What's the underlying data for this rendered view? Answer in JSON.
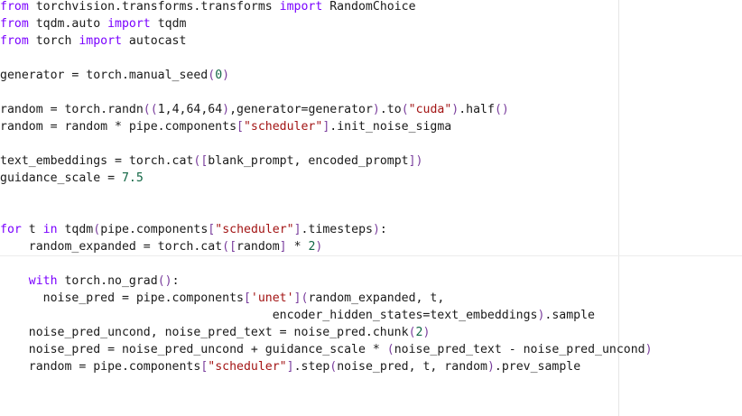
{
  "editor": {
    "lines": [
      [
        {
          "t": "from",
          "c": "kw"
        },
        {
          "t": " torchvision.transforms.transforms "
        },
        {
          "t": "import",
          "c": "kw"
        },
        {
          "t": " RandomChoice"
        }
      ],
      [
        {
          "t": "from",
          "c": "kw"
        },
        {
          "t": " tqdm.auto "
        },
        {
          "t": "import",
          "c": "kw"
        },
        {
          "t": " tqdm"
        }
      ],
      [
        {
          "t": "from",
          "c": "kw"
        },
        {
          "t": " torch "
        },
        {
          "t": "import",
          "c": "kw"
        },
        {
          "t": " autocast"
        }
      ],
      [],
      [
        {
          "t": "generator = torch.manual_seed"
        },
        {
          "t": "(",
          "c": "br"
        },
        {
          "t": "0",
          "c": "num"
        },
        {
          "t": ")",
          "c": "br"
        }
      ],
      [],
      [
        {
          "t": "random = torch.randn"
        },
        {
          "t": "((",
          "c": "br"
        },
        {
          "t": "1,4,64,64"
        },
        {
          "t": ")",
          "c": "br"
        },
        {
          "t": ",generator=generator"
        },
        {
          "t": ")",
          "c": "br"
        },
        {
          "t": ".to"
        },
        {
          "t": "(",
          "c": "br"
        },
        {
          "t": "\"cuda\"",
          "c": "str"
        },
        {
          "t": ")",
          "c": "br"
        },
        {
          "t": ".half"
        },
        {
          "t": "()",
          "c": "br"
        }
      ],
      [
        {
          "t": "random = random * pipe.components"
        },
        {
          "t": "[",
          "c": "br"
        },
        {
          "t": "\"scheduler\"",
          "c": "str"
        },
        {
          "t": "]",
          "c": "br"
        },
        {
          "t": ".init_noise_sigma"
        }
      ],
      [],
      [
        {
          "t": "text_embeddings = torch.cat"
        },
        {
          "t": "([",
          "c": "br"
        },
        {
          "t": "blank_prompt, encoded_prompt"
        },
        {
          "t": "])",
          "c": "br"
        }
      ],
      [
        {
          "t": "guidance_scale = "
        },
        {
          "t": "7.5",
          "c": "num"
        }
      ],
      [],
      [],
      [
        {
          "t": "for",
          "c": "kw"
        },
        {
          "t": " t "
        },
        {
          "t": "in",
          "c": "kw"
        },
        {
          "t": " tqdm"
        },
        {
          "t": "(",
          "c": "br"
        },
        {
          "t": "pipe.components"
        },
        {
          "t": "[",
          "c": "br"
        },
        {
          "t": "\"scheduler\"",
          "c": "str"
        },
        {
          "t": "]",
          "c": "br"
        },
        {
          "t": ".timesteps"
        },
        {
          "t": ")",
          "c": "br"
        },
        {
          "t": ":"
        }
      ],
      [
        {
          "t": "    random_expanded = torch.cat"
        },
        {
          "t": "([",
          "c": "br"
        },
        {
          "t": "random"
        },
        {
          "t": "]",
          "c": "br"
        },
        {
          "t": " * "
        },
        {
          "t": "2",
          "c": "num"
        },
        {
          "t": ")",
          "c": "br"
        }
      ],
      [],
      [
        {
          "t": "    "
        },
        {
          "t": "with",
          "c": "kw"
        },
        {
          "t": " torch.no_grad"
        },
        {
          "t": "()",
          "c": "br"
        },
        {
          "t": ":"
        }
      ],
      [
        {
          "t": "      noise_pred = pipe.components"
        },
        {
          "t": "[",
          "c": "br"
        },
        {
          "t": "'unet'",
          "c": "str"
        },
        {
          "t": "](",
          "c": "br"
        },
        {
          "t": "random_expanded, t,"
        }
      ],
      [
        {
          "t": "                                      encoder_hidden_states=text_embeddings"
        },
        {
          "t": ")",
          "c": "br"
        },
        {
          "t": ".sample"
        }
      ],
      [
        {
          "t": "    noise_pred_uncond, noise_pred_text = noise_pred.chunk"
        },
        {
          "t": "(",
          "c": "br"
        },
        {
          "t": "2",
          "c": "num"
        },
        {
          "t": ")",
          "c": "br"
        }
      ],
      [
        {
          "t": "    noise_pred = noise_pred_uncond + guidance_scale * "
        },
        {
          "t": "(",
          "c": "br"
        },
        {
          "t": "noise_pred_text - noise_pred_uncond"
        },
        {
          "t": ")",
          "c": "br"
        }
      ],
      [
        {
          "t": "    random = pipe.components"
        },
        {
          "t": "[",
          "c": "br"
        },
        {
          "t": "\"scheduler\"",
          "c": "str"
        },
        {
          "t": "]",
          "c": "br"
        },
        {
          "t": ".step"
        },
        {
          "t": "(",
          "c": "br"
        },
        {
          "t": "noise_pred, t, random"
        },
        {
          "t": ")",
          "c": "br"
        },
        {
          "t": ".prev_sample"
        }
      ]
    ],
    "cursor_line_index": 15,
    "colors": {
      "keyword": "#7a00ff",
      "string": "#a31515",
      "number": "#116644",
      "bracket": "#7a3e9d",
      "text": "#1a1a1a",
      "background": "#ffffff"
    }
  }
}
